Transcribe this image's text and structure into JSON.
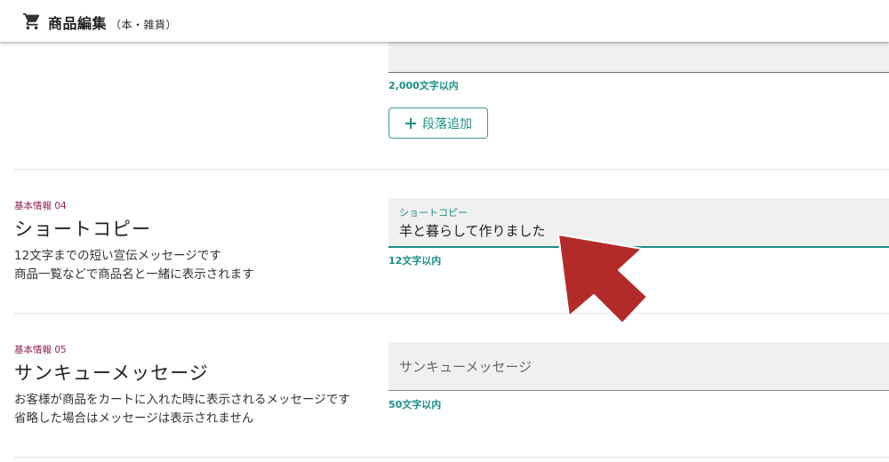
{
  "app": {
    "title": "商品編集",
    "subtitle": "（本・雑貨）",
    "icon": "cart-icon"
  },
  "section_top": {
    "hint": "2,000文字以内",
    "add_paragraph_label": "段落追加",
    "add_icon": "plus-icon"
  },
  "section_short_copy": {
    "caption": "基本情報 04",
    "heading": "ショートコピー",
    "description_line1": "12文字までの短い宣伝メッセージです",
    "description_line2": "商品一覧などで商品名と一緒に表示されます",
    "field_label": "ショートコピー",
    "field_value": "羊と暮らして作りました",
    "hint": "12文字以内"
  },
  "section_thank_you": {
    "caption": "基本情報 05",
    "heading": "サンキューメッセージ",
    "description_line1": "お客様が商品をカートに入れた時に表示されるメッセージです",
    "description_line2": "省略した場合はメッセージは表示されません",
    "field_placeholder": "サンキューメッセージ",
    "hint": "50文字以内"
  },
  "colors": {
    "accent": "#1a8f86",
    "caption": "#8c1f54",
    "arrow": "#b22b29"
  }
}
